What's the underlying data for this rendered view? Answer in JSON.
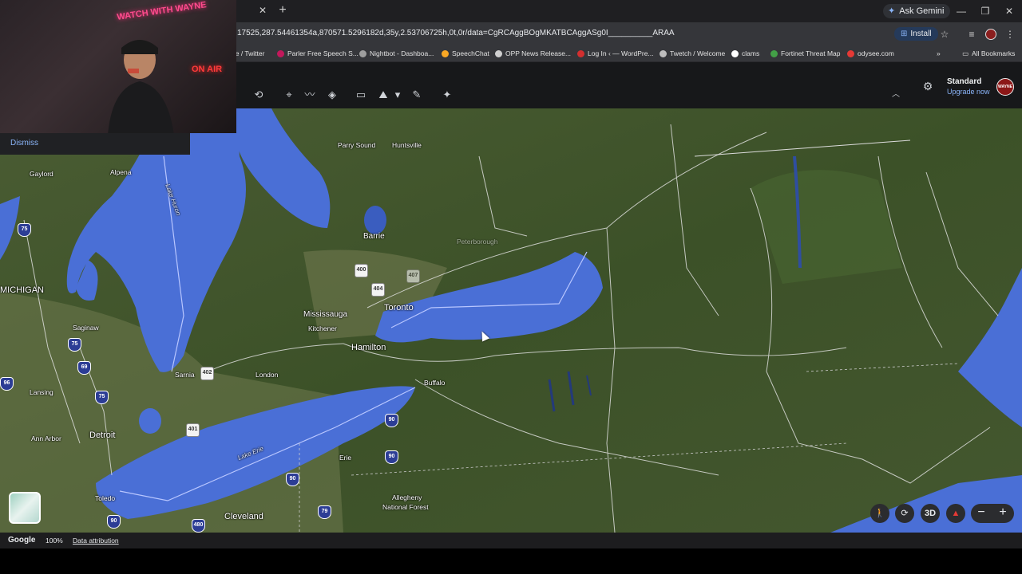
{
  "browser": {
    "url": "17525,287.54461354a,870571.5296182d,35y,2.53706725h,0t,0r/data=CgRCAggBOgMKATBCAggASg0I__________ARAA",
    "ask_gemini": "Ask Gemini",
    "install": "Install",
    "bookmarks": [
      {
        "label": "ne / Twitter",
        "color": "#444444"
      },
      {
        "label": "Parler Free Speech S...",
        "color": "#c2185b"
      },
      {
        "label": "Nightbot - Dashboa...",
        "color": "#9e9e9e"
      },
      {
        "label": "SpeechChat",
        "color": "#f9a825"
      },
      {
        "label": "OPP News Release...",
        "color": "#cfcfcf"
      },
      {
        "label": "Log In ‹ — WordPre...",
        "color": "#d32f2f"
      },
      {
        "label": "Twetch / Welcome",
        "color": "#bdbdbd"
      },
      {
        "label": "clams",
        "color": "#ffffff"
      },
      {
        "label": "Fortinet Threat Map",
        "color": "#43a047"
      },
      {
        "label": "odysee.com",
        "color": "#e53935"
      }
    ],
    "all_bookmarks": "All Bookmarks"
  },
  "earth": {
    "plan": "Standard",
    "upgrade": "Upgrade now",
    "avatar_text": "WAYNE"
  },
  "webcam": {
    "neon_top": "WATCH WITH WAYNE",
    "neon_air": "ON AIR",
    "dismiss": "Dismiss"
  },
  "map": {
    "labels": {
      "parry_sound": "Parry Sound",
      "huntsville": "Huntsville",
      "gaylord": "Gaylord",
      "alpena": "Alpena",
      "lake_huron": "Lake Huron",
      "barrie": "Barrie",
      "peterborough": "Peterborough",
      "michigan": "MICHIGAN",
      "toronto": "Toronto",
      "mississauga": "Mississauga",
      "kitchener": "Kitchener",
      "hamilton": "Hamilton",
      "saginaw": "Saginaw",
      "sarnia": "Sarnia",
      "london": "London",
      "buffalo": "Buffalo",
      "lansing": "Lansing",
      "detroit": "Detroit",
      "ann_arbor": "Ann Arbor",
      "lake_erie": "Lake Erie",
      "erie": "Erie",
      "toledo": "Toledo",
      "cleveland": "Cleveland",
      "allegheny": "Allegheny",
      "national_forest": "National Forest"
    },
    "shields": {
      "s400": "400",
      "s404": "404",
      "s407": "407",
      "s402": "402",
      "s401": "401",
      "s75a": "75",
      "s75b": "75",
      "s75c": "75",
      "s69": "69",
      "s96": "96",
      "s90a": "90",
      "s90b": "90",
      "s90c": "90",
      "s90d": "90",
      "s480": "480",
      "s79": "79"
    },
    "controls": {
      "threed": "3D"
    }
  },
  "footer": {
    "brand": "Google",
    "zoom": "100%",
    "attribution": "Data attribution"
  }
}
